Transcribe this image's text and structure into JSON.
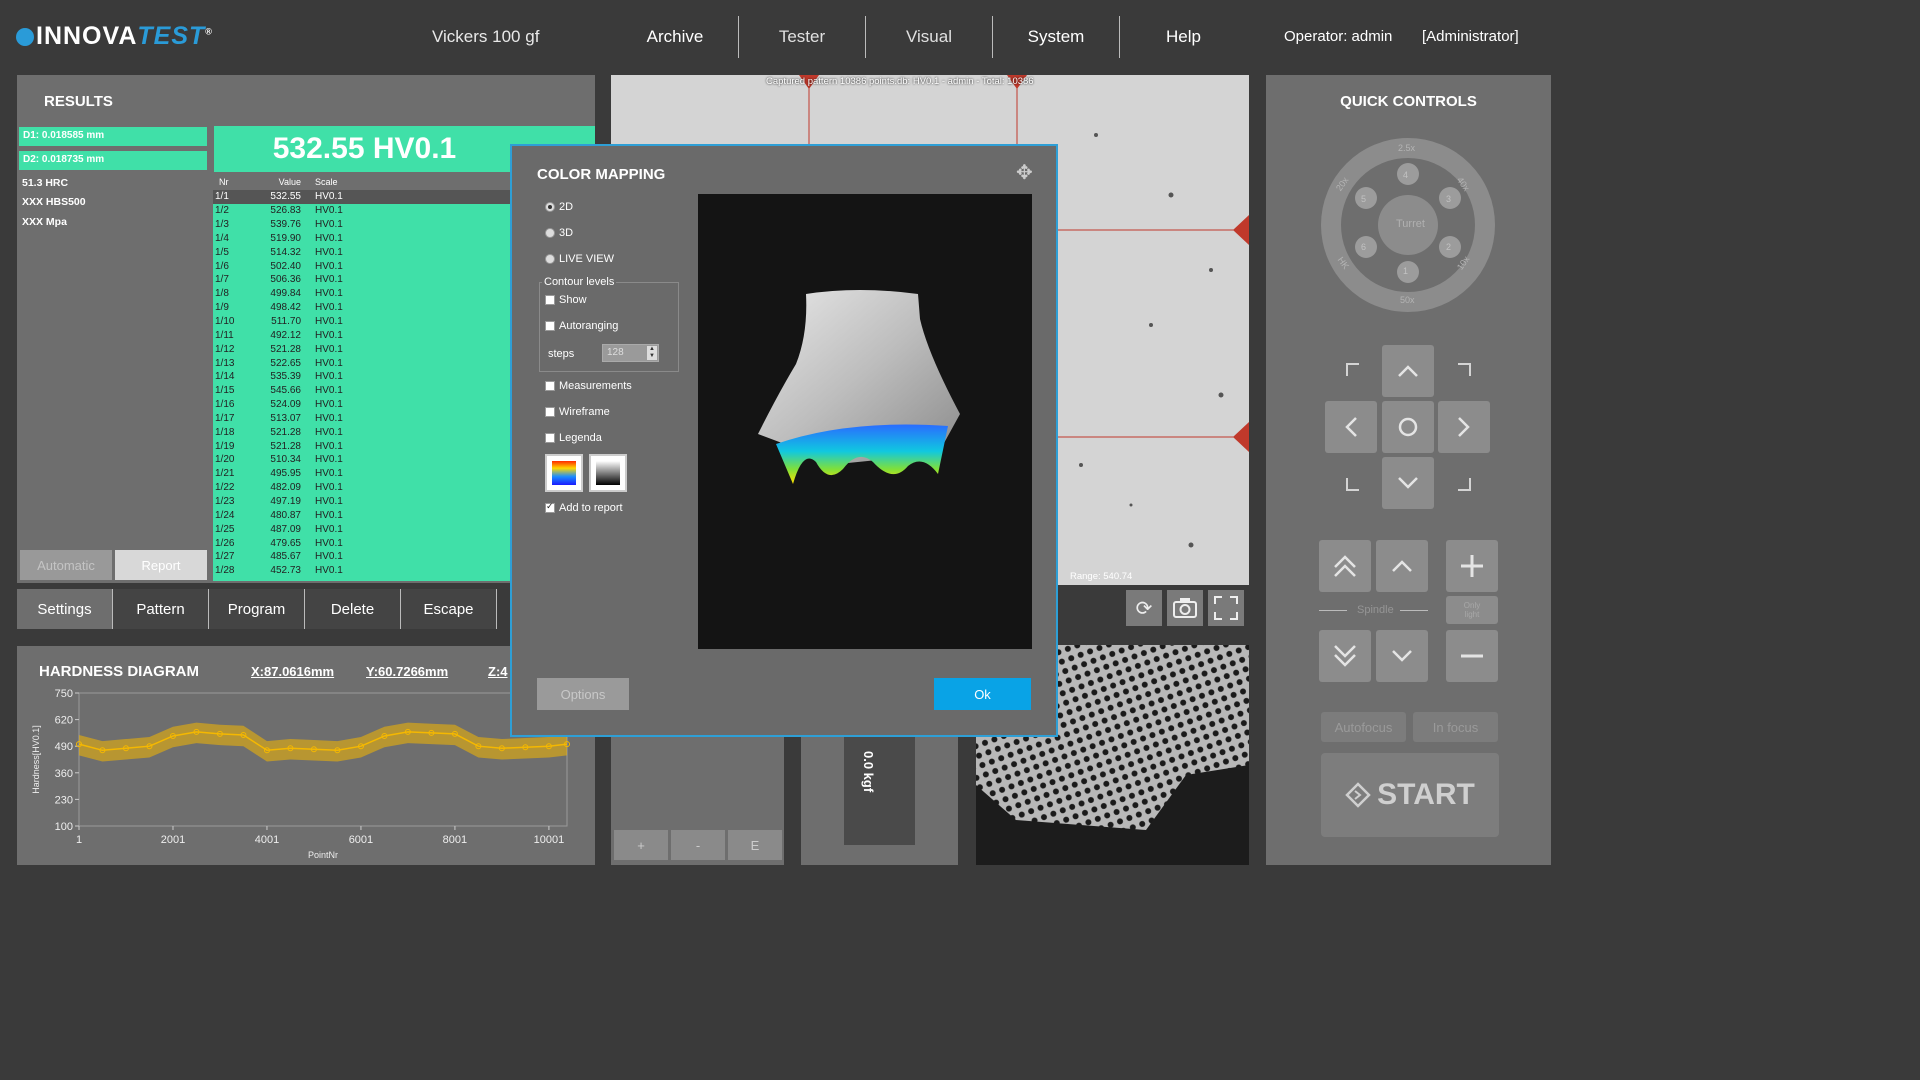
{
  "header": {
    "logo_main": "INNOVA",
    "logo_accent": "TEST",
    "logo_reg": "®",
    "mode": "Vickers 100 gf",
    "nav": [
      "Archive",
      "Tester",
      "Visual",
      "System",
      "Help"
    ],
    "operator": "Operator: admin",
    "role": "[Administrator]"
  },
  "results": {
    "title": "RESULTS",
    "d1": "D1: 0.018585 mm",
    "d2": "D2: 0.018735 mm",
    "hrc": "51.3 HRC",
    "hbs": "XXX HBS500",
    "mpa": "XXX Mpa",
    "big_value": "532.55 HV0.1",
    "columns": [
      "Nr",
      "Value",
      "Scale"
    ],
    "rows": [
      [
        "1/1",
        "532.55",
        "HV0.1"
      ],
      [
        "1/2",
        "526.83",
        "HV0.1"
      ],
      [
        "1/3",
        "539.76",
        "HV0.1"
      ],
      [
        "1/4",
        "519.90",
        "HV0.1"
      ],
      [
        "1/5",
        "514.32",
        "HV0.1"
      ],
      [
        "1/6",
        "502.40",
        "HV0.1"
      ],
      [
        "1/7",
        "506.36",
        "HV0.1"
      ],
      [
        "1/8",
        "499.84",
        "HV0.1"
      ],
      [
        "1/9",
        "498.42",
        "HV0.1"
      ],
      [
        "1/10",
        "511.70",
        "HV0.1"
      ],
      [
        "1/11",
        "492.12",
        "HV0.1"
      ],
      [
        "1/12",
        "521.28",
        "HV0.1"
      ],
      [
        "1/13",
        "522.65",
        "HV0.1"
      ],
      [
        "1/14",
        "535.39",
        "HV0.1"
      ],
      [
        "1/15",
        "545.66",
        "HV0.1"
      ],
      [
        "1/16",
        "524.09",
        "HV0.1"
      ],
      [
        "1/17",
        "513.07",
        "HV0.1"
      ],
      [
        "1/18",
        "521.28",
        "HV0.1"
      ],
      [
        "1/19",
        "521.28",
        "HV0.1"
      ],
      [
        "1/20",
        "510.34",
        "HV0.1"
      ],
      [
        "1/21",
        "495.95",
        "HV0.1"
      ],
      [
        "1/22",
        "482.09",
        "HV0.1"
      ],
      [
        "1/23",
        "497.19",
        "HV0.1"
      ],
      [
        "1/24",
        "480.87",
        "HV0.1"
      ],
      [
        "1/25",
        "487.09",
        "HV0.1"
      ],
      [
        "1/26",
        "479.65",
        "HV0.1"
      ],
      [
        "1/27",
        "485.67",
        "HV0.1"
      ],
      [
        "1/28",
        "452.73",
        "HV0.1"
      ]
    ],
    "automatic_label": "Automatic",
    "report_label": "Report"
  },
  "tabs": [
    "Settings",
    "Pattern",
    "Program",
    "Delete",
    "Escape"
  ],
  "diagram": {
    "title": "HARDNESS DIAGRAM",
    "x_coord": "X:87.0616mm",
    "y_coord": "Y:60.7266mm",
    "z_coord": "Z:4"
  },
  "chart_data": {
    "type": "line",
    "ylabel": "Hardness[HV0.1]",
    "xlabel": "PointNr",
    "ylim": [
      100,
      750
    ],
    "xlim": [
      1,
      10386
    ],
    "y_ticks": [
      "750",
      "620",
      "490",
      "360",
      "230",
      "100"
    ],
    "x_ticks": [
      "1",
      "2001",
      "4001",
      "6001",
      "8001",
      "10001"
    ],
    "series_color": "#f5b800",
    "series": [
      {
        "x": [
          1,
          500,
          1000,
          1500,
          2001,
          2500,
          3000,
          3500,
          4001,
          4500,
          5000,
          5500,
          6001,
          6500,
          7000,
          7500,
          8001,
          8500,
          9000,
          9500,
          10001,
          10386
        ],
        "values": [
          500,
          470,
          480,
          490,
          540,
          560,
          550,
          545,
          470,
          480,
          475,
          470,
          490,
          540,
          560,
          555,
          550,
          490,
          480,
          485,
          490,
          500
        ]
      }
    ]
  },
  "camera": {
    "caption": "Captured pattern 10386 points.db: HV0.1 - admin - Total: 10386",
    "range": "Range: 540.74",
    "icons": [
      "camera-rotate-icon",
      "camera-icon",
      "fullscreen-icon"
    ]
  },
  "small_panel": {
    "buttons": [
      "+",
      "-",
      "E"
    ]
  },
  "force": {
    "label": "0.0 kgf"
  },
  "quick": {
    "title": "QUICK CONTROLS",
    "turret_label": "Turret",
    "turret_positions": [
      "4",
      "3",
      "2",
      "1",
      "6",
      "5"
    ],
    "objectives": [
      "2.5x",
      "40x",
      "10x",
      "50x",
      "HK",
      "20x"
    ],
    "spindle_label": "Spindle",
    "only_light": "Only light",
    "autofocus": "Autofocus",
    "in_focus": "In focus",
    "start": "START"
  },
  "dialog": {
    "title": "COLOR MAPPING",
    "view_2d": "2D",
    "view_3d": "3D",
    "live_view": "LIVE VIEW",
    "contour_levels": "Contour levels",
    "show": "Show",
    "autoranging": "Autoranging",
    "steps_label": "steps",
    "steps_value": "128",
    "measurements": "Measurements",
    "wireframe": "Wireframe",
    "legenda": "Legenda",
    "add_to_report": "Add to report",
    "options": "Options",
    "ok": "Ok"
  }
}
